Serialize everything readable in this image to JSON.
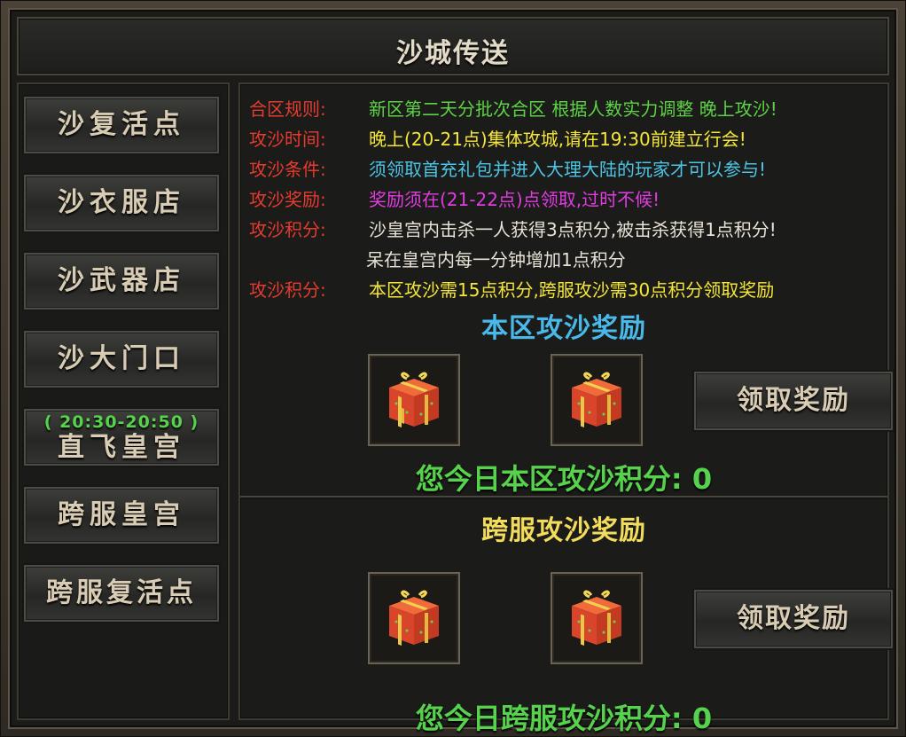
{
  "window": {
    "title": "沙城传送"
  },
  "sidebar": {
    "buttons": [
      {
        "label": "沙复活点"
      },
      {
        "label": "沙衣服店"
      },
      {
        "label": "沙武器店"
      },
      {
        "label": "沙大门口"
      },
      {
        "time": "( 20:30-20:50 )",
        "label": "直飞皇宫"
      },
      {
        "label": "跨服皇宫"
      },
      {
        "label": "跨服复活点"
      }
    ]
  },
  "rules": [
    {
      "key": "合区规则:",
      "value": "新区第二天分批次合区 根据人数实力调整 晚上攻沙!",
      "color": "#5ed246"
    },
    {
      "key": "攻沙时间:",
      "value": "晚上(20-21点)集体攻城,请在19:30前建立行会!",
      "color": "#f5e63a"
    },
    {
      "key": "攻沙条件:",
      "value": "须领取首充礼包并进入大理大陆的玩家才可以参与!",
      "color": "#4cc4e6"
    },
    {
      "key": "攻沙奖励:",
      "value": "奖励须在(21-22点)点领取,过时不候!",
      "color": "#e03ce0"
    },
    {
      "key": "攻沙积分:",
      "value": "沙皇宫内击杀一人获得3点积分,被击杀获得1点积分!",
      "color": "#e8e2d6"
    },
    {
      "key": "攻沙积分:",
      "value": "本区攻沙需15点积分,跨服攻沙需30点积分领取奖励",
      "color": "#f5e63a"
    }
  ],
  "rules_continuation": "呆在皇宫内每一分钟增加1点积分",
  "local_section": {
    "title": "本区攻沙奖励",
    "title_color": "#49b9ea",
    "claim_label": "领取奖励",
    "score_text": "您今日本区攻沙积分: 0"
  },
  "cross_section": {
    "title": "跨服攻沙奖励",
    "title_color": "#f2dc5c",
    "claim_label": "领取奖励",
    "score_text": "您今日跨服攻沙积分: 0"
  },
  "reward_item": {
    "icon": "gift-box-icon"
  }
}
